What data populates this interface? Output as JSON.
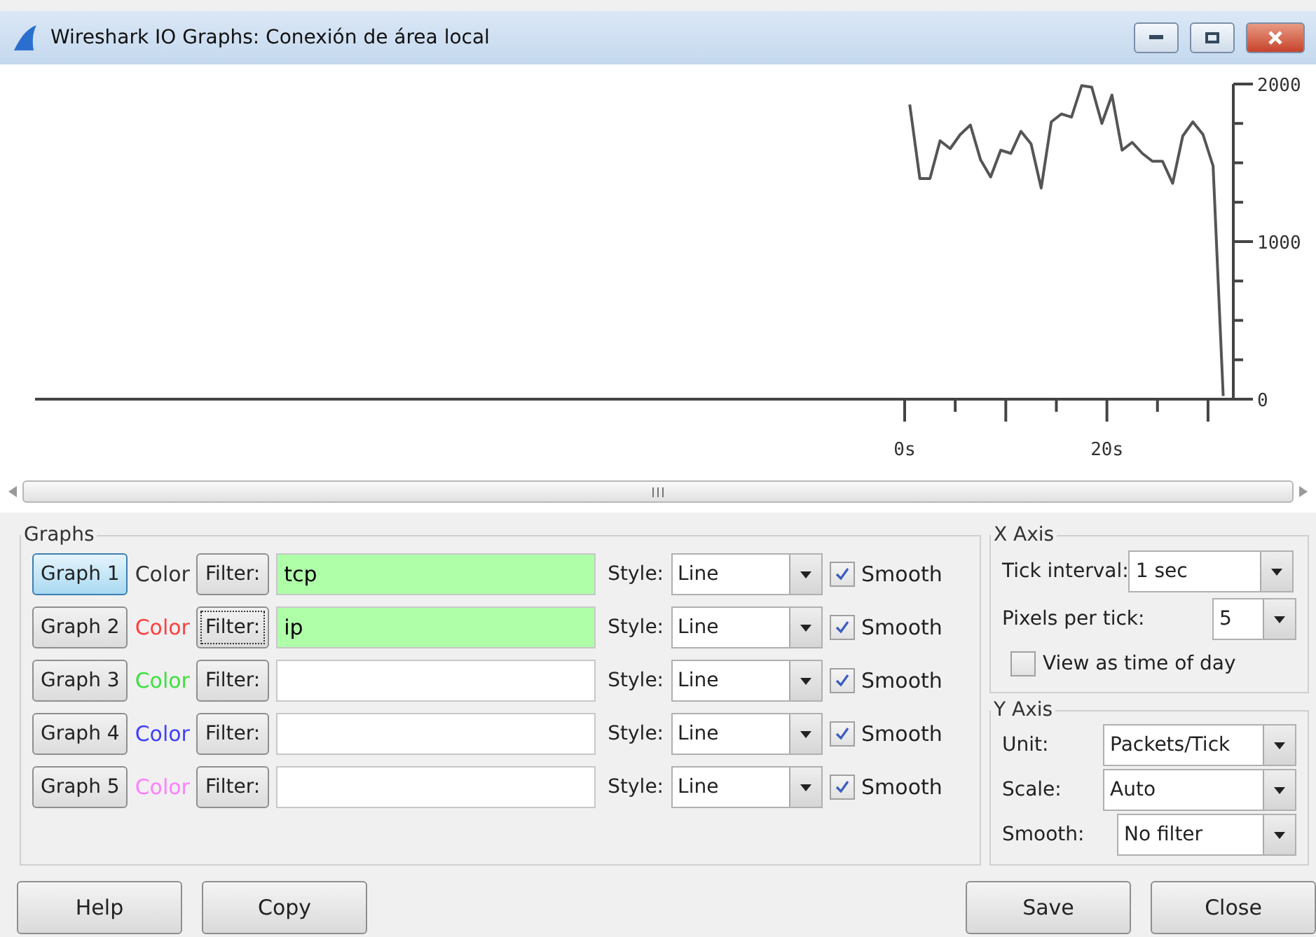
{
  "window": {
    "title": "Wireshark IO Graphs: Conexión de área local"
  },
  "chart": {
    "chart_data": {
      "type": "line",
      "xlim": [
        -86,
        32.5
      ],
      "ylim": [
        0,
        2000
      ],
      "xticks": [
        {
          "value": 0,
          "label": "0s"
        },
        {
          "value": 20,
          "label": "20s"
        }
      ],
      "yticks": [
        0,
        1000,
        2000
      ],
      "x": [
        0.5,
        1.5,
        2.5,
        3.5,
        4.5,
        5.5,
        6.5,
        7.5,
        8.5,
        9.5,
        10.5,
        11.5,
        12.5,
        13.5,
        14.5,
        15.5,
        16.5,
        17.5,
        18.5,
        19.5,
        20.5,
        21.5,
        22.5,
        23.5,
        24.5,
        25.5,
        26.5,
        27.5,
        28.5,
        29.5,
        30.5,
        31.5
      ],
      "series": [
        {
          "color": "#555555",
          "values": [
            1870,
            1400,
            1400,
            1640,
            1590,
            1680,
            1740,
            1520,
            1410,
            1580,
            1560,
            1700,
            1620,
            1340,
            1760,
            1810,
            1790,
            1990,
            1980,
            1750,
            1930,
            1580,
            1630,
            1560,
            1510,
            1510,
            1370,
            1670,
            1760,
            1680,
            1480,
            20
          ]
        }
      ]
    }
  },
  "graphs": {
    "title": "Graphs",
    "rows": [
      {
        "graph": "Graph 1",
        "selected": true,
        "color_label": "Color",
        "color": "#333333",
        "filter_button": "Filter:",
        "filter_focused": false,
        "filter": "tcp",
        "filter_valid": true,
        "style_label": "Style:",
        "style": "Line",
        "smooth": "Smooth",
        "checked": true
      },
      {
        "graph": "Graph 2",
        "selected": false,
        "color_label": "Color",
        "color": "#ff4040",
        "filter_button": "Filter:",
        "filter_focused": true,
        "filter": "ip",
        "filter_valid": true,
        "style_label": "Style:",
        "style": "Line",
        "smooth": "Smooth",
        "checked": true
      },
      {
        "graph": "Graph 3",
        "selected": false,
        "color_label": "Color",
        "color": "#40e040",
        "filter_button": "Filter:",
        "filter_focused": false,
        "filter_valid": false,
        "style_label": "Style:",
        "style": "Line",
        "smooth": "Smooth",
        "checked": true
      },
      {
        "graph": "Graph 4",
        "selected": false,
        "color_label": "Color",
        "color": "#4040ff",
        "filter_button": "Filter:",
        "filter_focused": false,
        "filter_valid": false,
        "style_label": "Style:",
        "style": "Line",
        "smooth": "Smooth",
        "checked": true
      },
      {
        "graph": "Graph 5",
        "selected": false,
        "color_label": "Color",
        "color": "#ff80ff",
        "filter_button": "Filter:",
        "filter_focused": false,
        "filter_valid": false,
        "style_label": "Style:",
        "style": "Line",
        "smooth": "Smooth",
        "checked": true
      }
    ]
  },
  "x_axis": {
    "title": "X Axis",
    "tick_interval": {
      "label": "Tick interval:",
      "value": "1 sec"
    },
    "pixels_per_tick": {
      "label": "Pixels per tick:",
      "value": "5"
    },
    "view_as_time_of_day": {
      "label": "View as time of day",
      "checked": false
    }
  },
  "y_axis": {
    "title": "Y Axis",
    "fields": [
      {
        "label": "Unit:",
        "value": "Packets/Tick"
      },
      {
        "label": "Scale:",
        "value": "Auto"
      },
      {
        "label": "Smooth:",
        "value": "No filter"
      }
    ]
  },
  "buttons_left": [
    "Help",
    "Copy"
  ],
  "buttons_right": [
    "Save",
    "Close"
  ]
}
